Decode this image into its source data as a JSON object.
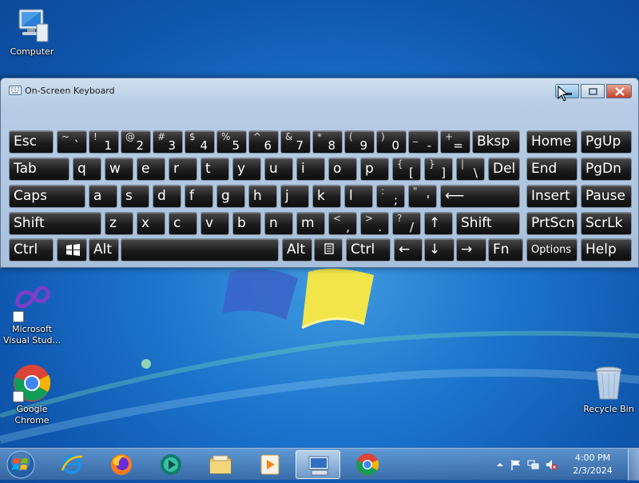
{
  "desktop": {
    "icons": [
      {
        "name": "computer",
        "label": "Computer"
      },
      {
        "name": "visual-studio",
        "label": "Microsoft Visual Stud..."
      },
      {
        "name": "chrome",
        "label": "Google Chrome"
      },
      {
        "name": "recycle-bin",
        "label": "Recycle Bin"
      }
    ]
  },
  "osk": {
    "title": "On-Screen Keyboard",
    "rows": [
      [
        {
          "main": "Esc"
        },
        {
          "shift": "~",
          "main": "`"
        },
        {
          "shift": "!",
          "main": "1"
        },
        {
          "shift": "@",
          "main": "2"
        },
        {
          "shift": "#",
          "main": "3"
        },
        {
          "shift": "$",
          "main": "4"
        },
        {
          "shift": "%",
          "main": "5"
        },
        {
          "shift": "^",
          "main": "6"
        },
        {
          "shift": "&",
          "main": "7"
        },
        {
          "shift": "*",
          "main": "8"
        },
        {
          "shift": "(",
          "main": "9"
        },
        {
          "shift": ")",
          "main": "0"
        },
        {
          "shift": "_",
          "main": "-"
        },
        {
          "shift": "+",
          "main": "="
        },
        {
          "main": "Bksp"
        },
        {
          "main": "Home"
        },
        {
          "main": "PgUp"
        }
      ],
      [
        {
          "main": "Tab"
        },
        {
          "main": "q"
        },
        {
          "main": "w"
        },
        {
          "main": "e"
        },
        {
          "main": "r"
        },
        {
          "main": "t"
        },
        {
          "main": "y"
        },
        {
          "main": "u"
        },
        {
          "main": "i"
        },
        {
          "main": "o"
        },
        {
          "main": "p"
        },
        {
          "shift": "{",
          "main": "["
        },
        {
          "shift": "}",
          "main": "]"
        },
        {
          "shift": "|",
          "main": "\\"
        },
        {
          "main": "Del"
        },
        {
          "main": "End"
        },
        {
          "main": "PgDn"
        }
      ],
      [
        {
          "main": "Caps"
        },
        {
          "main": "a"
        },
        {
          "main": "s"
        },
        {
          "main": "d"
        },
        {
          "main": "f"
        },
        {
          "main": "g"
        },
        {
          "main": "h"
        },
        {
          "main": "j"
        },
        {
          "main": "k"
        },
        {
          "main": "l"
        },
        {
          "shift": ":",
          "main": ";"
        },
        {
          "shift": "\"",
          "main": "'"
        },
        {
          "main": "⟵"
        },
        {
          "main": "Insert"
        },
        {
          "main": "Pause"
        }
      ],
      [
        {
          "main": "Shift"
        },
        {
          "main": "z"
        },
        {
          "main": "x"
        },
        {
          "main": "c"
        },
        {
          "main": "v"
        },
        {
          "main": "b"
        },
        {
          "main": "n"
        },
        {
          "main": "m"
        },
        {
          "shift": "<",
          "main": ","
        },
        {
          "shift": ">",
          "main": "."
        },
        {
          "shift": "?",
          "main": "/"
        },
        {
          "main": "↑"
        },
        {
          "main": "Shift"
        },
        {
          "main": "PrtScn"
        },
        {
          "main": "ScrLk"
        }
      ],
      [
        {
          "main": "Ctrl"
        },
        {
          "main": ""
        },
        {
          "main": "Alt"
        },
        {
          "main": ""
        },
        {
          "main": "Alt"
        },
        {
          "main": ""
        },
        {
          "main": "Ctrl"
        },
        {
          "main": "←"
        },
        {
          "main": "↓"
        },
        {
          "main": "→"
        },
        {
          "main": "Fn"
        },
        {
          "main": "Options"
        },
        {
          "main": "Help"
        }
      ]
    ]
  },
  "taskbar": {
    "clock_time": "4:00 PM",
    "clock_date": "2/3/2024"
  }
}
